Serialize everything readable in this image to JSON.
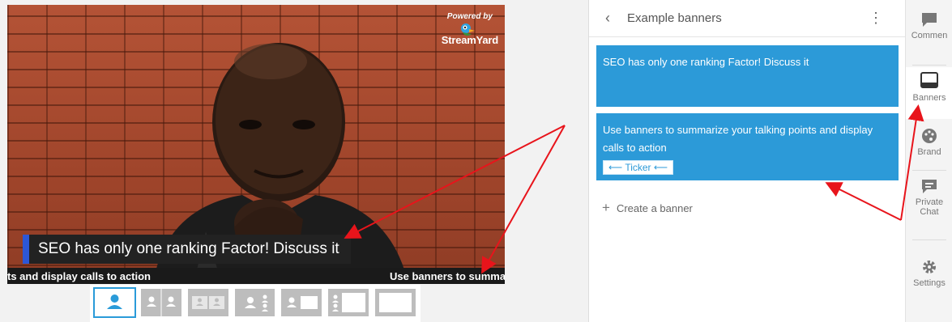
{
  "stage": {
    "logo_powered": "Powered by",
    "logo_name": "StreamYard",
    "banner_text": "SEO has only one ranking Factor! Discuss it",
    "ticker_left": "ts and display calls to action",
    "ticker_right": "Use banners to summar"
  },
  "layouts": [
    "solo",
    "split-two",
    "grid-small",
    "group",
    "presenter-small",
    "presenter-large",
    "fullscreen"
  ],
  "panel": {
    "back_icon": "chevron-left-icon",
    "title": "Example banners",
    "menu_icon": "kebab-icon",
    "banners": [
      {
        "text": "SEO has only one ranking Factor! Discuss it"
      },
      {
        "text": "Use banners to summarize your talking points and display calls to action",
        "chip": "⟵ Ticker ⟵"
      }
    ],
    "create_label": "Create a banner"
  },
  "rail": [
    {
      "label": "Commen",
      "icon": "comment-icon"
    },
    {
      "label": "Banners",
      "icon": "banner-icon",
      "selected": true
    },
    {
      "label": "Brand",
      "icon": "palette-icon"
    },
    {
      "label": "Private Chat",
      "label_line1": "Private",
      "label_line2": "Chat",
      "icon": "private-chat-icon"
    },
    {
      "label": "Settings",
      "icon": "gear-icon"
    }
  ],
  "colors": {
    "banner_blue": "#2c9ad8",
    "overlay_accent": "#2d57d6",
    "arrow_red": "#e8141b"
  }
}
